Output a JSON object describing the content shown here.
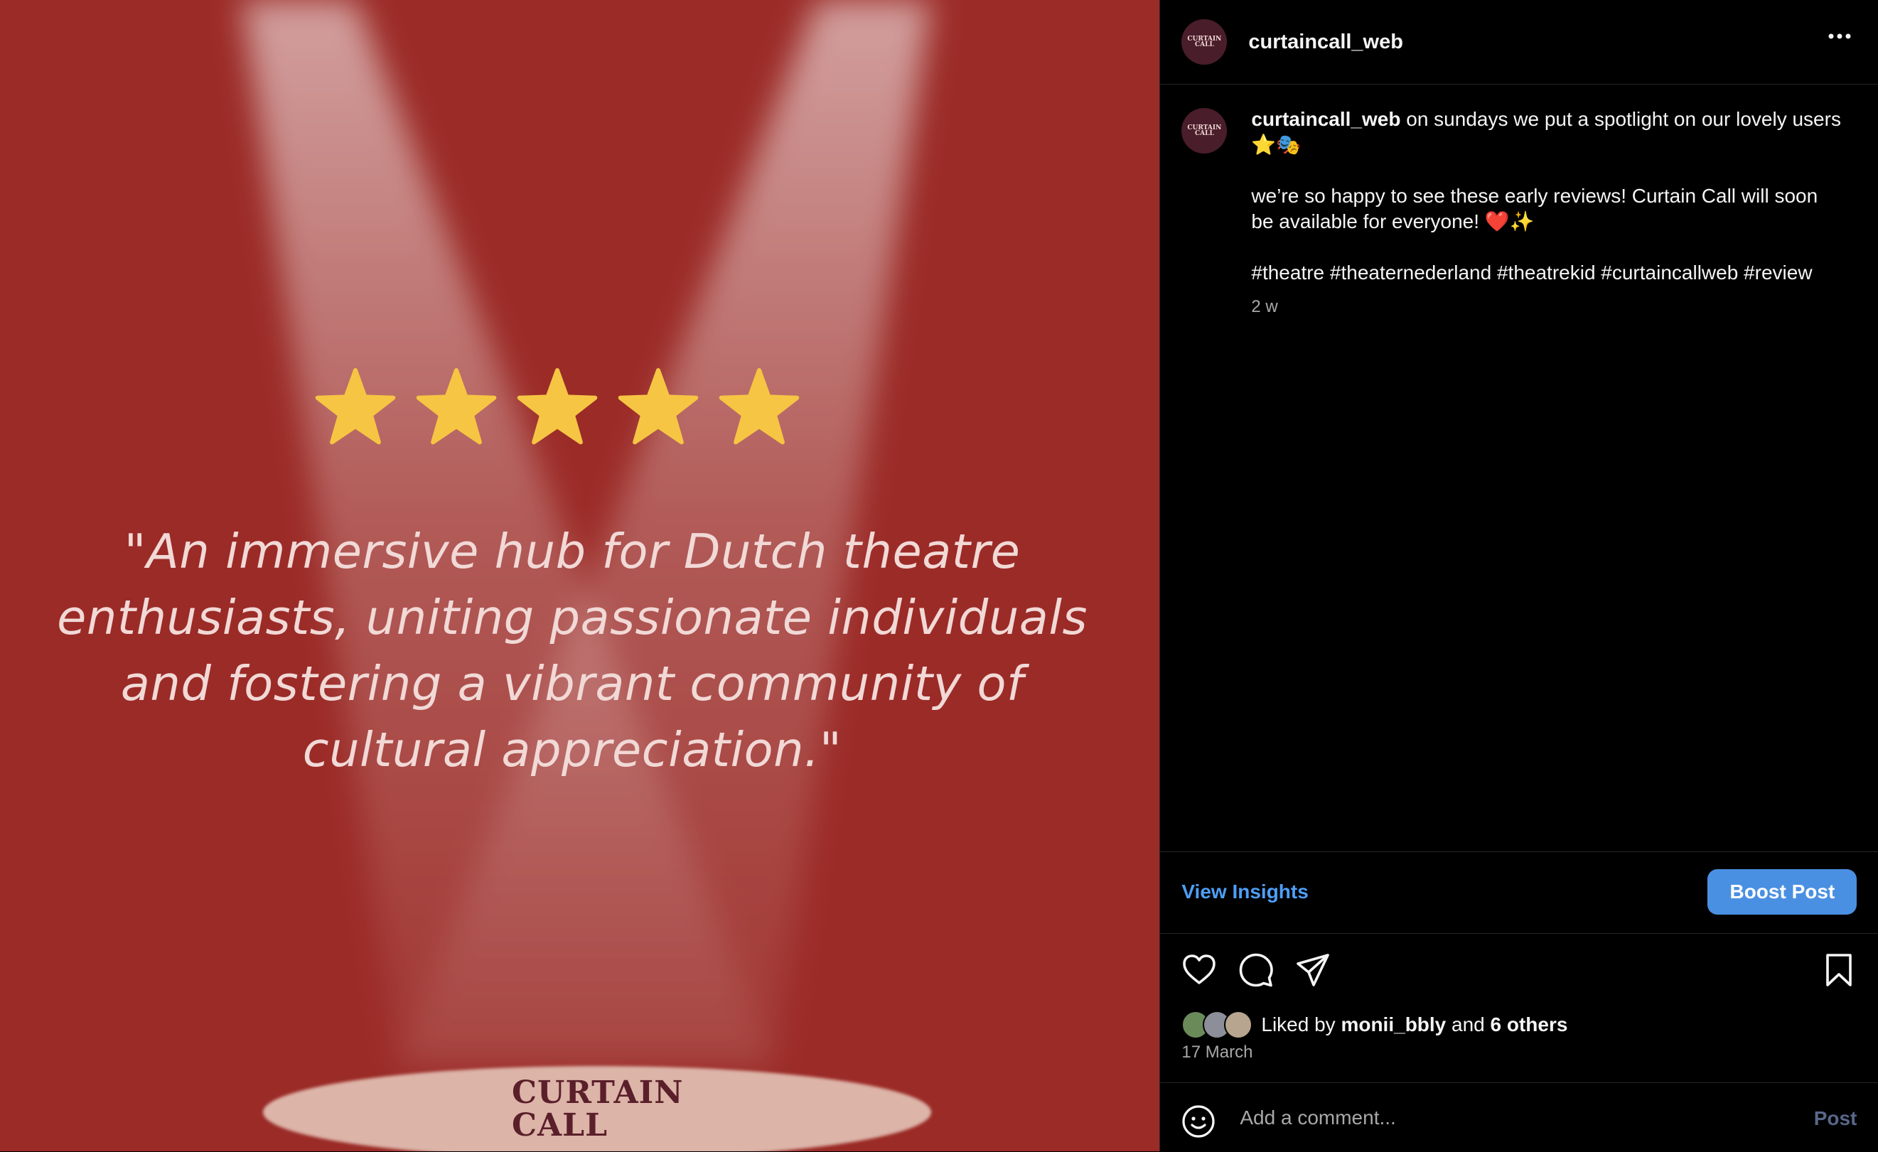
{
  "media": {
    "rating_stars": 5,
    "star_color": "#f6c543",
    "background_color": "#9b2b27",
    "quote": "\"An immersive hub for Dutch theatre enthusiasts, uniting passionate individuals and fostering a vibrant community of cultural appreciation.\"",
    "logo_line1": "CURTAIN",
    "logo_line2": "CALL"
  },
  "header": {
    "username": "curtaincall_web",
    "avatar_text": "CURTAIN CALL",
    "more_icon": "more-horizontal-icon"
  },
  "caption": {
    "username": "curtaincall_web",
    "line1": " on sundays we put a spotlight on our lovely users ⭐️🎭",
    "line2": "we’re so happy to see these early reviews! Curtain Call will soon be available for everyone! ❤️✨",
    "hashtags": "#theatre #theaternederland #theatrekid #curtaincallweb #review",
    "time": "2 w"
  },
  "insights": {
    "view_label": "View Insights",
    "boost_label": "Boost Post",
    "accent_color": "#4a90e2"
  },
  "actions": {
    "icons": [
      "heart-icon",
      "comment-icon",
      "share-icon",
      "bookmark-icon"
    ]
  },
  "likes": {
    "prefix": "Liked by",
    "user": "monii_bbly",
    "and": "and",
    "others": "6 others",
    "date": "17 March"
  },
  "comment": {
    "placeholder": "Add a comment...",
    "post_label": "Post",
    "emoji_icon": "smiley-icon"
  }
}
